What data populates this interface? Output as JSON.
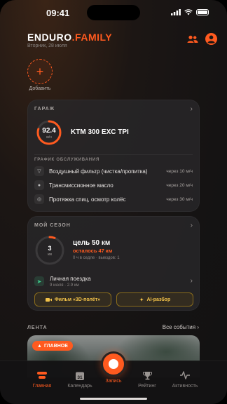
{
  "status_bar": {
    "time": "09:41"
  },
  "header": {
    "brand_part1": "ENDURO",
    "brand_part2": ".FAMILY",
    "date": "Вторник, 28 июля"
  },
  "stories": {
    "add_label": "Добавить"
  },
  "garage": {
    "title": "ГАРАЖ",
    "engine_hours": "92.4",
    "engine_hours_unit": "м/ч",
    "engine_hours_progress": 0.8,
    "bike_name": "KTM 300 EXC TPI",
    "schedule_title": "ГРАФИК ОБСЛУЖИВАНИЯ",
    "services": [
      {
        "icon": "filter-icon",
        "name": "Воздушный фильтр (чистка/пропитка)",
        "due": "через 10 м/ч"
      },
      {
        "icon": "oil-drop-icon",
        "name": "Трансмиссионное масло",
        "due": "через 20 м/ч"
      },
      {
        "icon": "spoke-icon",
        "name": "Протяжка спиц, осмотр колёс",
        "due": "через 30 м/ч"
      }
    ]
  },
  "season": {
    "title": "МОЙ СЕЗОН",
    "km": "3",
    "km_unit": "км",
    "progress": 0.06,
    "goal": "цель 50 км",
    "left": "осталось 47 км",
    "saddle": "0 ч в седле · выездов: 1",
    "trip": {
      "name": "Личная поездка",
      "meta": "9 июля · 2.9 км"
    },
    "film_button": "Фильм «3D-полёт»",
    "ai_button": "AI-разбор"
  },
  "feed": {
    "title": "ЛЕНТА",
    "all_events": "Все события",
    "badge": "ГЛАВНОЕ"
  },
  "tabbar": {
    "home": "Главная",
    "calendar": "Календарь",
    "calendar_day": "31",
    "record": "Запись",
    "rating": "Рейтинг",
    "activity": "Активность"
  },
  "colors": {
    "accent": "#ff5a1f",
    "gold": "#f2c24a",
    "green": "#3fcf8e"
  }
}
